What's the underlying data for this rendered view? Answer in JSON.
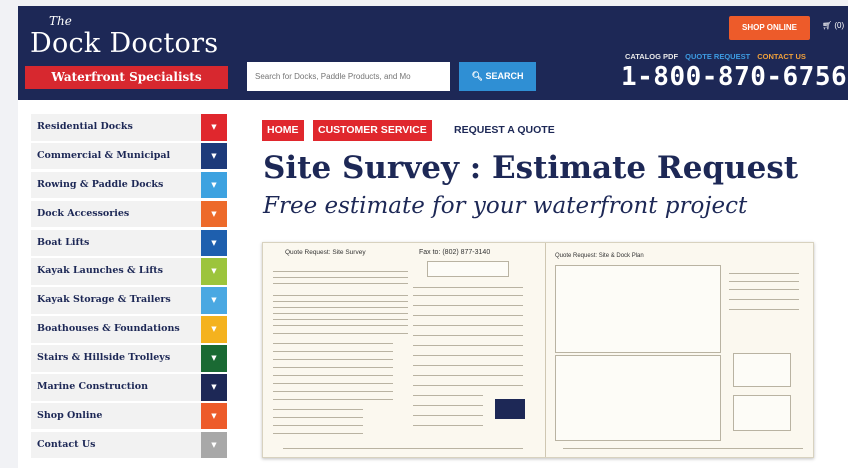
{
  "header": {
    "logo": {
      "the": "The",
      "name": "Dock Doctors",
      "tagline": "Waterfront Specialists"
    },
    "search": {
      "placeholder": "Search for Docks, Paddle Products, and Mo",
      "button_label": "SEARCH"
    },
    "shop_online_label": "SHOP ONLINE",
    "cart_label": "(0)",
    "links": {
      "catalog": "CATALOG PDF",
      "quote": "QUOTE REQUEST",
      "contact": "CONTACT US"
    },
    "phone": "1-800-870-6756"
  },
  "sidebar": {
    "items": [
      {
        "label": "Residential Docks",
        "color": "#e0272d"
      },
      {
        "label": "Commercial & Municipal",
        "color": "#1d3a7a"
      },
      {
        "label": "Rowing & Paddle Docks",
        "color": "#3da2e0"
      },
      {
        "label": "Dock Accessories",
        "color": "#ed6a2a"
      },
      {
        "label": "Boat Lifts",
        "color": "#1e5fae"
      },
      {
        "label": "Kayak Launches & Lifts",
        "color": "#9cc43c"
      },
      {
        "label": "Kayak Storage & Trailers",
        "color": "#4aa8e2"
      },
      {
        "label": "Boathouses & Foundations",
        "color": "#f4b21e"
      },
      {
        "label": "Stairs & Hillside Trolleys",
        "color": "#1a6a33"
      },
      {
        "label": "Marine Construction",
        "color": "#1d2856"
      },
      {
        "label": "Shop Online",
        "color": "#ed5b2a"
      },
      {
        "label": "Contact Us",
        "color": "#a8a8a8"
      }
    ]
  },
  "breadcrumb": {
    "home": "HOME",
    "customer_service": "CUSTOMER SERVICE",
    "current": "REQUEST A QUOTE"
  },
  "page": {
    "title": "Site Survey : Estimate Request",
    "subtitle": "Free estimate for your waterfront project"
  },
  "preview": {
    "left_heading": "Quote Request: Site Survey",
    "fax": "Fax to: (802) 877-3140",
    "right_heading": "Quote Request: Site & Dock Plan"
  }
}
